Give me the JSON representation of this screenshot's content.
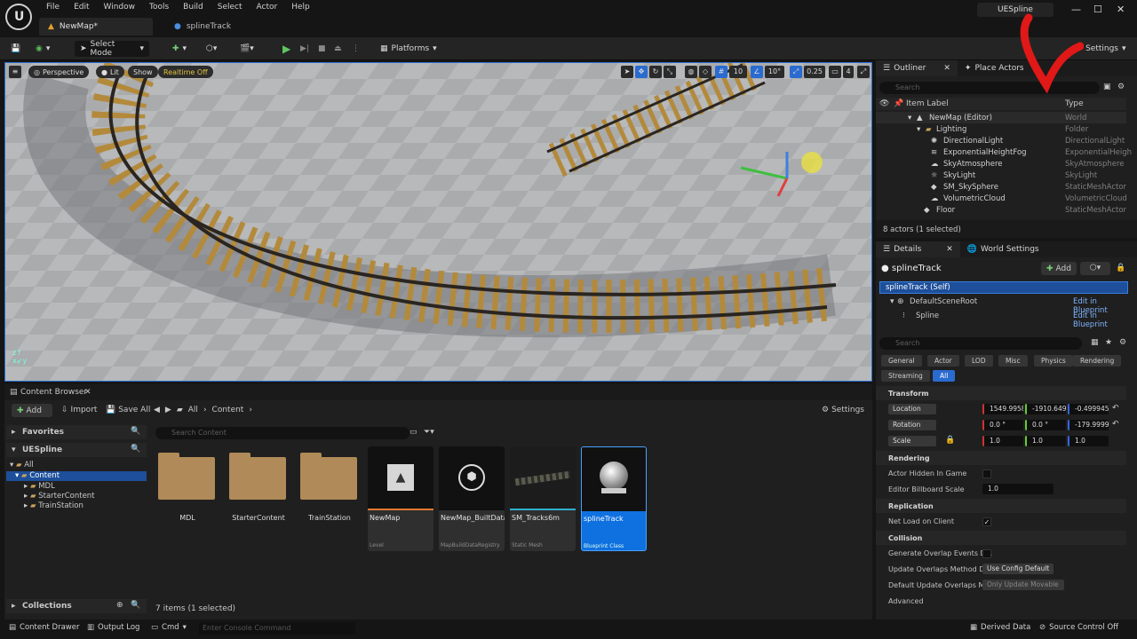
{
  "menu": [
    "File",
    "Edit",
    "Window",
    "Tools",
    "Build",
    "Select",
    "Actor",
    "Help"
  ],
  "doc_tabs": [
    {
      "label": "NewMap*"
    },
    {
      "label": "splineTrack"
    }
  ],
  "project_name": "UESpline",
  "toolbar": {
    "select_mode": "Select Mode",
    "platforms": "Platforms",
    "settings": "Settings"
  },
  "viewport": {
    "perspective": "Perspective",
    "lit": "Lit",
    "show": "Show",
    "realtime": "Realtime Off",
    "grid_snap": "10",
    "rot_snap": "10°",
    "scale_snap": "0.25",
    "cam_speed": "4"
  },
  "outliner": {
    "tab": "Outliner",
    "place_actors": "Place Actors",
    "search_placeholder": "Search",
    "col_label": "Item Label",
    "col_type": "Type",
    "rows": [
      {
        "label": "NewMap (Editor)",
        "type": "World"
      },
      {
        "label": "Lighting",
        "type": "Folder"
      },
      {
        "label": "DirectionalLight",
        "type": "DirectionalLight"
      },
      {
        "label": "ExponentialHeightFog",
        "type": "ExponentialHeigh"
      },
      {
        "label": "SkyAtmosphere",
        "type": "SkyAtmosphere"
      },
      {
        "label": "SkyLight",
        "type": "SkyLight"
      },
      {
        "label": "SM_SkySphere",
        "type": "StaticMeshActor"
      },
      {
        "label": "VolumetricCloud",
        "type": "VolumetricCloud"
      },
      {
        "label": "Floor",
        "type": "StaticMeshActor"
      }
    ],
    "status": "8 actors (1 selected)"
  },
  "details": {
    "tab": "Details",
    "world_settings": "World Settings",
    "actor_name": "splineTrack",
    "add": "Add",
    "components": [
      {
        "label": "splineTrack (Self)",
        "link": ""
      },
      {
        "label": "DefaultSceneRoot",
        "link": "Edit in Blueprint"
      },
      {
        "label": "Spline",
        "link": "Edit in Blueprint"
      }
    ],
    "search_placeholder": "Search",
    "categories": [
      "General",
      "Actor",
      "LOD",
      "Misc",
      "Physics",
      "Rendering",
      "Streaming",
      "All"
    ],
    "transform": {
      "header": "Transform",
      "location": {
        "label": "Location",
        "x": "1549.99583",
        "y": "-1910.6490",
        "z": "-0.499945"
      },
      "rotation": {
        "label": "Rotation",
        "x": "0.0 °",
        "y": "0.0 °",
        "z": "-179.99999"
      },
      "scale": {
        "label": "Scale",
        "x": "1.0",
        "y": "1.0",
        "z": "1.0"
      }
    },
    "rendering": {
      "header": "Rendering",
      "hidden": "Actor Hidden In Game",
      "billboard": "Editor Billboard Scale",
      "billboard_value": "1.0"
    },
    "replication": {
      "header": "Replication",
      "net_load": "Net Load on Client"
    },
    "collision": {
      "header": "Collision",
      "gen_overlap": "Generate Overlap Events D...",
      "update_method": "Update Overlaps Method D...",
      "update_method_value": "Use Config Default",
      "default_update": "Default Update Overlaps M...",
      "default_update_value": "Only Update Movable"
    },
    "advanced": "Advanced"
  },
  "content_browser": {
    "title": "Content Browser",
    "add": "Add",
    "import": "Import",
    "save_all": "Save All",
    "breadcrumb": [
      "All",
      "Content"
    ],
    "settings": "Settings",
    "favorites": "Favorites",
    "project": "UESpline",
    "tree": [
      "All",
      "Content",
      "MDL",
      "StarterContent",
      "TrainStation"
    ],
    "search_placeholder": "Search Content",
    "folders": [
      "MDL",
      "StarterContent",
      "TrainStation"
    ],
    "assets": [
      {
        "name": "NewMap",
        "class": "Level"
      },
      {
        "name": "NewMap_BuiltData",
        "class": "MapBuildDataRegistry"
      },
      {
        "name": "SM_Tracks6m",
        "class": "Static Mesh"
      },
      {
        "name": "splineTrack",
        "class": "Blueprint Class"
      }
    ],
    "collections": "Collections",
    "status": "7 items (1 selected)"
  },
  "statusbar": {
    "content_drawer": "Content Drawer",
    "output_log": "Output Log",
    "cmd": "Cmd",
    "console_placeholder": "Enter Console Command",
    "derived_data": "Derived Data",
    "source_control": "Source Control Off"
  }
}
